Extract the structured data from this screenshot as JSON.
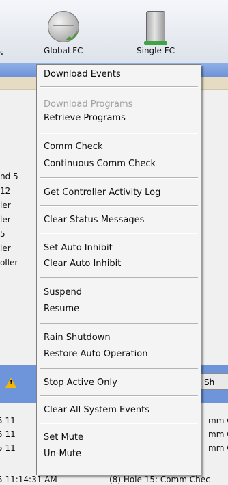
{
  "toolbar": {
    "left_fragment": "s",
    "global_fc_label": "Global FC",
    "single_fc_label": "Single FC"
  },
  "background": {
    "left_column": [
      "nd 5",
      "12",
      "ler",
      "ler",
      "5",
      "ler",
      "oller"
    ],
    "show_button_label": "Sh",
    "log_rows": [
      {
        "left": "5 11",
        "right": "mm C"
      },
      {
        "left": "5 11",
        "right": "mm C"
      },
      {
        "left": "5 11",
        "right": "mm C"
      },
      {
        "left": "5 11:14:31 AM",
        "right": "(8)  Hole 15: Comm Chec"
      }
    ]
  },
  "menu": {
    "items": [
      {
        "label": "Download Events",
        "enabled": true
      },
      {
        "label": "Download Programs",
        "enabled": false
      },
      {
        "label": "Retrieve Programs",
        "enabled": true
      },
      {
        "label": "Comm Check",
        "enabled": true
      },
      {
        "label": "Continuous Comm Check",
        "enabled": true
      },
      {
        "label": "Get Controller Activity Log",
        "enabled": true
      },
      {
        "label": "Clear Status Messages",
        "enabled": true
      },
      {
        "label": "Set Auto Inhibit",
        "enabled": true
      },
      {
        "label": "Clear Auto Inhibit",
        "enabled": true
      },
      {
        "label": "Suspend",
        "enabled": true
      },
      {
        "label": "Resume",
        "enabled": true
      },
      {
        "label": "Rain Shutdown",
        "enabled": true
      },
      {
        "label": "Restore Auto Operation",
        "enabled": true
      },
      {
        "label": "Stop Active Only",
        "enabled": true
      },
      {
        "label": "Clear All System Events",
        "enabled": true
      },
      {
        "label": "Set Mute",
        "enabled": true
      },
      {
        "label": "Un-Mute",
        "enabled": true
      }
    ]
  },
  "colors": {
    "menu_bg": "#f4f4f4",
    "disabled_text": "#a3a3a3",
    "blue_band": "#6e95d9",
    "tan_band": "#e5dcc3"
  }
}
